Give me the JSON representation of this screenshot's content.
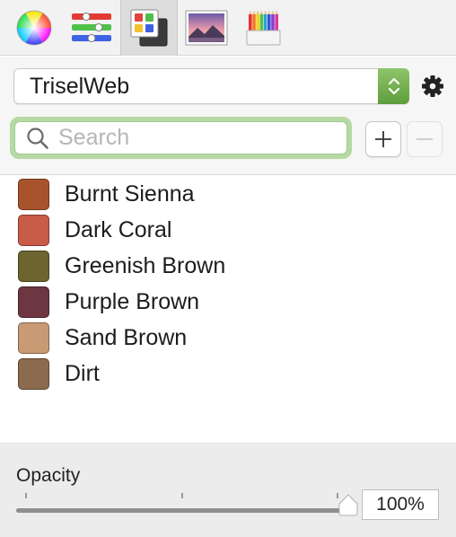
{
  "toolbar": {
    "tabs": [
      {
        "name": "color-wheel",
        "icon": "color-wheel-icon",
        "active": false
      },
      {
        "name": "color-sliders",
        "icon": "sliders-icon",
        "active": false
      },
      {
        "name": "color-palettes",
        "icon": "palettes-icon",
        "active": true
      },
      {
        "name": "image-palettes",
        "icon": "image-icon",
        "active": false
      },
      {
        "name": "pencils",
        "icon": "pencils-icon",
        "active": false
      }
    ]
  },
  "palette_selector": {
    "value": "TriselWeb",
    "icon": "gear-icon"
  },
  "search": {
    "placeholder": "Search",
    "value": ""
  },
  "buttons": {
    "add": "+",
    "remove": "−"
  },
  "colors": [
    {
      "name": "Burnt Sienna",
      "hex": "#a9532d"
    },
    {
      "name": "Dark Coral",
      "hex": "#c95b49"
    },
    {
      "name": "Greenish Brown",
      "hex": "#6d6530"
    },
    {
      "name": "Purple Brown",
      "hex": "#6d3641"
    },
    {
      "name": "Sand Brown",
      "hex": "#c99a73"
    },
    {
      "name": "Dirt",
      "hex": "#8b6a4e"
    }
  ],
  "opacity": {
    "label": "Opacity",
    "value_text": "100%",
    "value": 1.0
  }
}
